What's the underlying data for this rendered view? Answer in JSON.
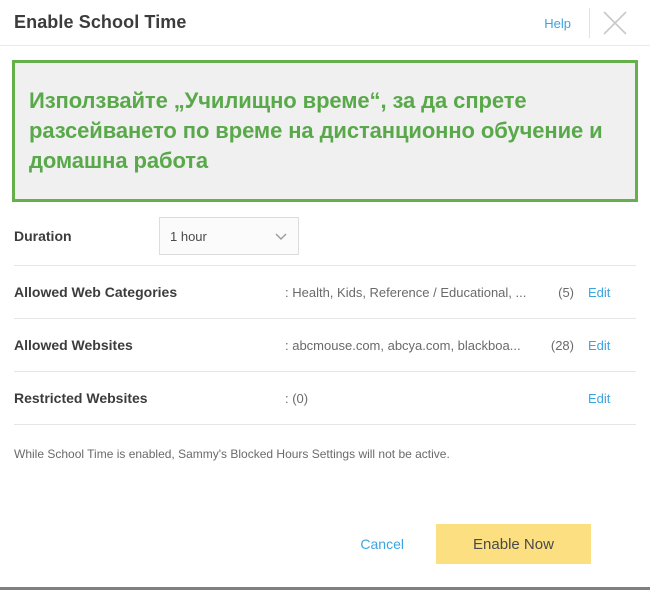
{
  "header": {
    "title": "Enable School Time",
    "help_label": "Help",
    "close_icon": "close-icon"
  },
  "banner": {
    "message": "Използвайте „Училищно време“, за да спрете разсейването по време на дистанционно обучение и домашна работа",
    "border_color": "#66b04b",
    "text_color": "#59a94a",
    "background_color": "#f0f0f0"
  },
  "duration": {
    "label": "Duration",
    "value": "1 hour",
    "chevron_icon": "chevron-down-icon"
  },
  "rows": [
    {
      "label": "Allowed Web Categories",
      "value": ": Health, Kids, Reference / Educational, ...",
      "count": "(5)",
      "edit_label": "Edit"
    },
    {
      "label": "Allowed Websites",
      "value": ": abcmouse.com, abcya.com, blackboa...",
      "count": "(28)",
      "edit_label": "Edit"
    },
    {
      "label": "Restricted Websites",
      "value": ": (0)",
      "count": "",
      "edit_label": "Edit"
    }
  ],
  "note": "While School Time is enabled, Sammy's Blocked Hours Settings will not be active.",
  "footer": {
    "cancel_label": "Cancel",
    "enable_label": "Enable Now",
    "enable_color": "#fbdf80"
  },
  "colors": {
    "link": "#3ba5e0",
    "title": "#3c3c3c",
    "muted": "#6a6a6a"
  }
}
